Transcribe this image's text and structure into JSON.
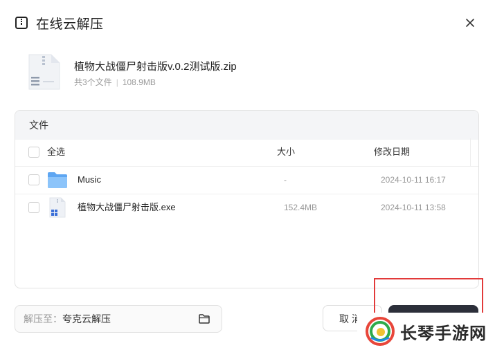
{
  "dialog": {
    "title": "在线云解压",
    "close_label": "×"
  },
  "archive": {
    "name": "植物大战僵尸射击版v.0.2测试版.zip",
    "file_count": "共3个文件",
    "size": "108.9MB"
  },
  "file_panel": {
    "tab_label": "文件",
    "columns": {
      "select_all": "全选",
      "size": "大小",
      "modified": "修改日期"
    },
    "rows": [
      {
        "name": "Music",
        "size": "-",
        "modified": "2024-10-11 16:17",
        "icon": "folder-icon"
      },
      {
        "name": "植物大战僵尸射击版.exe",
        "size": "152.4MB",
        "modified": "2024-10-11 13:58",
        "icon": "exe-file-icon"
      }
    ]
  },
  "destination": {
    "label": "解压至：",
    "value": "夸克云解压",
    "icon": "folder-outline-icon"
  },
  "buttons": {
    "cancel": "取 消",
    "confirm": ""
  },
  "watermark": {
    "text": "长琴手游网"
  },
  "colors": {
    "primary_button": "#2c2f3a",
    "highlight": "#e23a3a",
    "folder": "#6aaef5"
  }
}
